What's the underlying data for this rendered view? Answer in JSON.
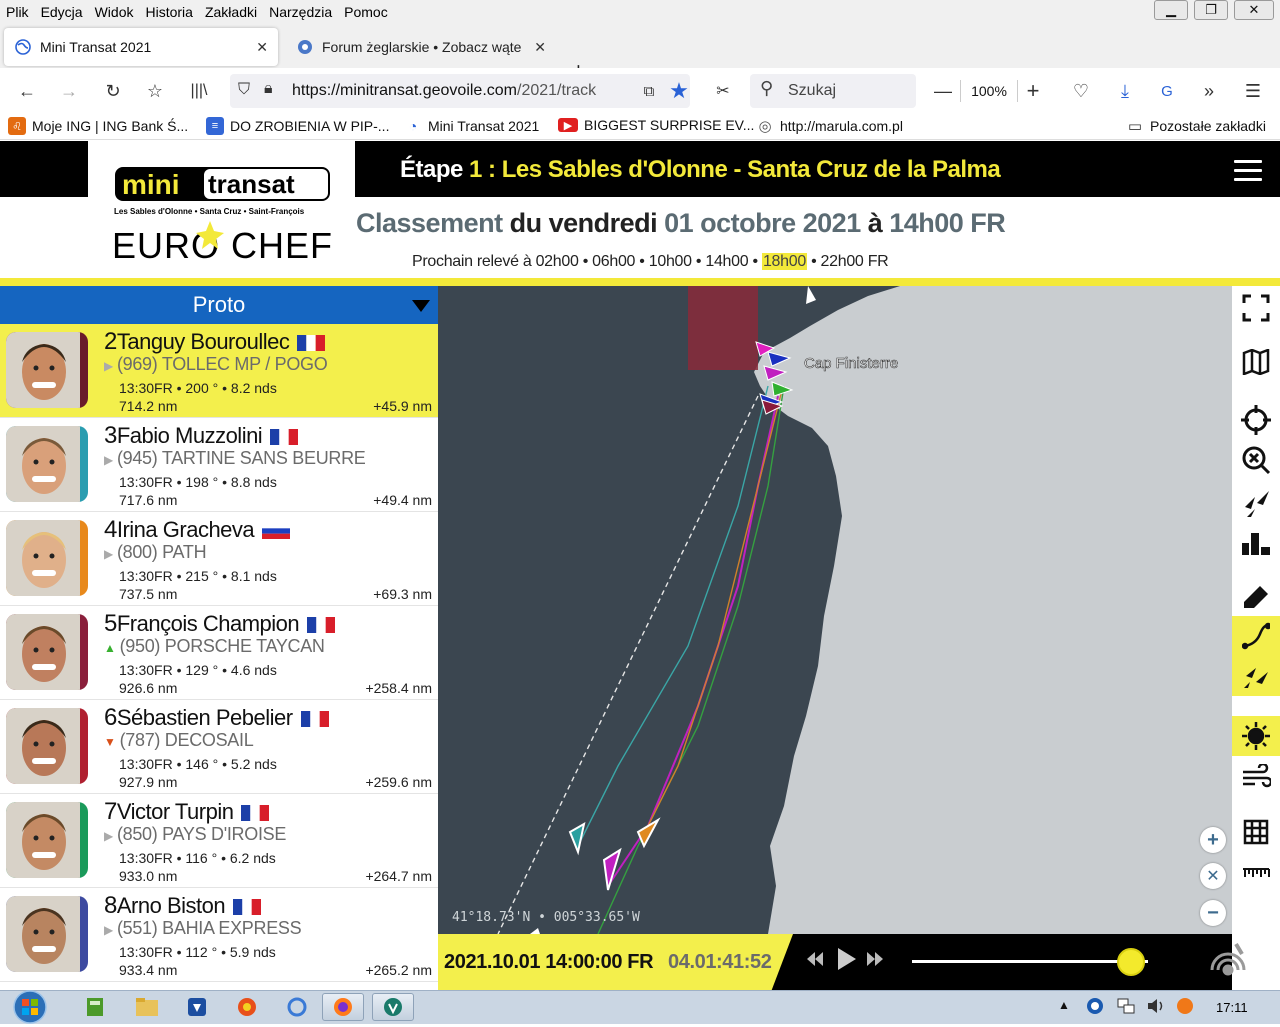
{
  "menubar": [
    "Plik",
    "Edycja",
    "Widok",
    "Historia",
    "Zakładki",
    "Narzędzia",
    "Pomoc"
  ],
  "tabs": [
    {
      "label": "Mini Transat 2021",
      "icon": "globe-icon"
    },
    {
      "label": "Forum żeglarskie • Zobacz wąte",
      "icon": "forum-icon"
    }
  ],
  "nav": {
    "url_host": "https://minitransat.geovoile.com",
    "url_path": "/2021/track",
    "search_placeholder": "Szukaj",
    "zoom": "100%"
  },
  "bookmarks": [
    {
      "label": "Moje ING | ING Bank Ś...",
      "icon": "ing-lion-icon",
      "color": "#e36b10"
    },
    {
      "label": "DO ZROBIENIA W PIP-...",
      "icon": "document-icon",
      "color": "#3367d6"
    },
    {
      "label": "Mini Transat 2021",
      "icon": "globe-icon",
      "color": "#2a62d6"
    },
    {
      "label": "BIGGEST SURPRISE EV...",
      "icon": "youtube-icon",
      "color": "#e02020"
    },
    {
      "label": "http://marula.com.pl",
      "icon": "globe-icon",
      "color": "#555555"
    }
  ],
  "other_bookmarks": "Pozostałe zakładki",
  "site": {
    "logo_line1": "mini",
    "logo_line2": "transat",
    "logo_route": "Les Sables d'Olonne • Santa Cruz • Saint-François",
    "logo_sponsor": "EURO CHEF",
    "etape_prefix": "Étape ",
    "etape_num": "1 :",
    "etape_route": " Les Sables d'Olonne - Santa Cruz de la Palma",
    "class_label": "Classement",
    "class_du": " du vendredi ",
    "class_date": "01 octobre 2021",
    "class_a": " à ",
    "class_time": "14h00 FR",
    "releve_label": "Prochain relevé à ",
    "releve_times": [
      "02h00",
      "06h00",
      "10h00",
      "14h00"
    ],
    "releve_next": "18h00",
    "releve_last": "22h00",
    "releve_tz": "FR"
  },
  "ranking": {
    "category": "Proto",
    "rows": [
      {
        "rank": "2",
        "name": "Tanguy Bouroullec",
        "flag": "fr",
        "trend": "▶",
        "trend_color": "#aaaaaa",
        "boat": "(969) TOLLEC MP / POGO",
        "stats": "13:30FR • 200 ° • 8.2 nds",
        "dist": "714.2 nm",
        "gap": "+45.9 nm",
        "accent": "#6a1b2a"
      },
      {
        "rank": "3",
        "name": "Fabio Muzzolini",
        "flag": "fr",
        "trend": "▶",
        "trend_color": "#aaaaaa",
        "boat": "(945) TARTINE SANS BEURRE",
        "stats": "13:30FR • 198 ° • 8.8 nds",
        "dist": "717.6 nm",
        "gap": "+49.4 nm",
        "accent": "#2a9db0"
      },
      {
        "rank": "4",
        "name": "Irina Gracheva",
        "flag": "ru",
        "trend": "▶",
        "trend_color": "#aaaaaa",
        "boat": "(800) PATH",
        "stats": "13:30FR • 215 ° • 8.1 nds",
        "dist": "737.5 nm",
        "gap": "+69.3 nm",
        "accent": "#e8891c"
      },
      {
        "rank": "5",
        "name": "François Champion",
        "flag": "fr",
        "trend": "▲",
        "trend_color": "#38b030",
        "boat": "(950) PORSCHE TAYCAN",
        "stats": "13:30FR • 129 ° • 4.6 nds",
        "dist": "926.6 nm",
        "gap": "+258.4 nm",
        "accent": "#8a1f3b"
      },
      {
        "rank": "6",
        "name": "Sébastien Pebelier",
        "flag": "fr",
        "trend": "▼",
        "trend_color": "#d8501a",
        "boat": "(787) DECOSAIL",
        "stats": "13:30FR • 146 ° • 5.2 nds",
        "dist": "927.9 nm",
        "gap": "+259.6 nm",
        "accent": "#b02030"
      },
      {
        "rank": "7",
        "name": "Victor Turpin",
        "flag": "fr",
        "trend": "▶",
        "trend_color": "#aaaaaa",
        "boat": "(850) PAYS D'IROISE",
        "stats": "13:30FR • 116 ° • 6.2 nds",
        "dist": "933.0 nm",
        "gap": "+264.7 nm",
        "accent": "#1a9a5a"
      },
      {
        "rank": "8",
        "name": "Arno Biston",
        "flag": "fr",
        "trend": "▶",
        "trend_color": "#aaaaaa",
        "boat": "(551) BAHIA EXPRESS",
        "stats": "13:30FR • 112 ° • 5.9 nds",
        "dist": "933.4 nm",
        "gap": "+265.2 nm",
        "accent": "#3d4aa0"
      }
    ]
  },
  "map": {
    "place_label": "Cap Finisterre",
    "coords": "41°18.73'N • 005°33.65'W",
    "sea_color": "#3b4650",
    "land_color": "#c9cdd0"
  },
  "player": {
    "datetime": "2021.10.01 14:00:00 FR",
    "elapsed": "04.01:41:52",
    "progress": 0.93
  },
  "colors": {
    "brand_yellow": "#f3ef4c",
    "brand_blue": "#1565c0"
  },
  "taskbar": {
    "clock": "17:11"
  }
}
